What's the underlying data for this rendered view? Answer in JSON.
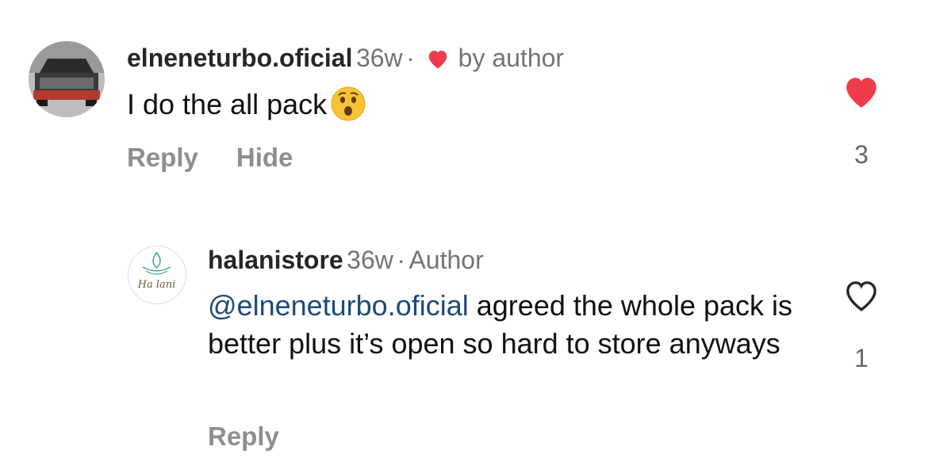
{
  "comment1": {
    "username": "elneneturbo.oficial",
    "time": "36w",
    "separator": "·",
    "liked_label": "by author",
    "text": "I do the all pack",
    "emoji_icon": "astonished-face-emoji",
    "reply_label": "Reply",
    "hide_label": "Hide",
    "like_count": "3",
    "liked": true
  },
  "comment2": {
    "username": "halanistore",
    "time": "36w",
    "separator": "·",
    "badge": "Author",
    "mention": "@elneneturbo.oficial",
    "text": "agreed the whole pack is better plus it’s open so hard to store anyways",
    "avatar_text": "Ha lani",
    "reply_label": "Reply",
    "like_count": "1",
    "liked": false
  },
  "colors": {
    "heart_red": "#ed3d4d",
    "mention_blue": "#1d4a7a",
    "muted_gray": "#8e8e8e"
  }
}
